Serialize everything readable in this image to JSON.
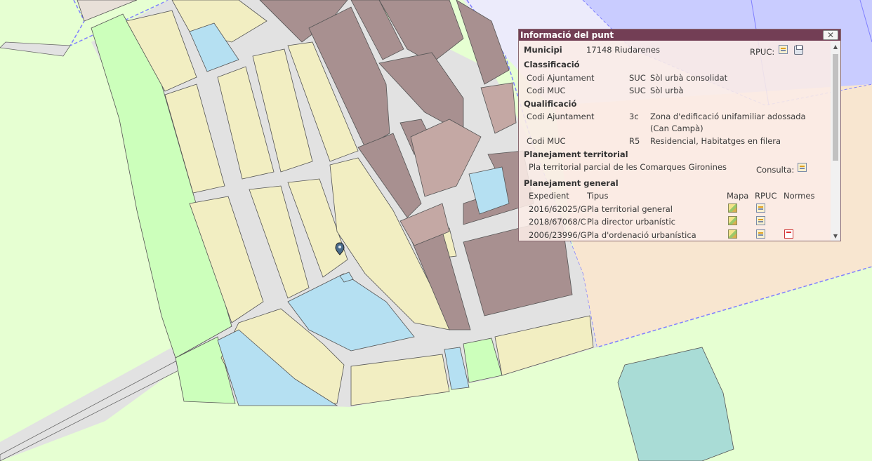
{
  "popup": {
    "title": "Informació del punt",
    "close_icon": "close-icon",
    "municipi_label": "Municipi",
    "municipi_value": "17148 Riudarenes",
    "rpuc_label": "RPUC:",
    "classificacio": {
      "heading": "Classificació",
      "rows": [
        {
          "label": "Codi Ajuntament",
          "code": "SUC",
          "desc": "Sòl urbà consolidat"
        },
        {
          "label": "Codi MUC",
          "code": "SUC",
          "desc": "Sòl urbà"
        }
      ]
    },
    "qualificacio": {
      "heading": "Qualificació",
      "rows": [
        {
          "label": "Codi Ajuntament",
          "code": "3c",
          "desc": "Zona d'edificació unifamiliar adossada",
          "desc2": "(Can Campà)"
        },
        {
          "label": "Codi MUC",
          "code": "R5",
          "desc": "Residencial, Habitatges en filera"
        }
      ]
    },
    "planejament_territorial": {
      "heading": "Planejament territorial",
      "text": "Pla territorial parcial de les Comarques Gironines",
      "consulta_label": "Consulta:"
    },
    "planejament_general": {
      "heading": "Planejament general",
      "columns": [
        "Expedient",
        "Tipus",
        "Mapa",
        "RPUC",
        "Normes"
      ],
      "rows": [
        {
          "expedient": "2016/62025/G",
          "tipus": "Pla territorial general"
        },
        {
          "expedient": "2018/67068/C",
          "tipus": "Pla director urbanístic"
        },
        {
          "expedient": "2006/23996/G",
          "tipus": "Pla d'ordenació urbanística"
        }
      ]
    }
  },
  "colors": {
    "title_bar": "#733e55",
    "rural_land": "#e6ffd2",
    "green_space": "#ccffbb",
    "residential": "#f2eec2",
    "old_town": "#a89090",
    "facility": "#b5e0f2",
    "road": "#e2e2e2",
    "boundary": "#8080ff",
    "water_pond": "#a9dcd6"
  },
  "map": {
    "marker_icon": "location-pin-icon"
  }
}
